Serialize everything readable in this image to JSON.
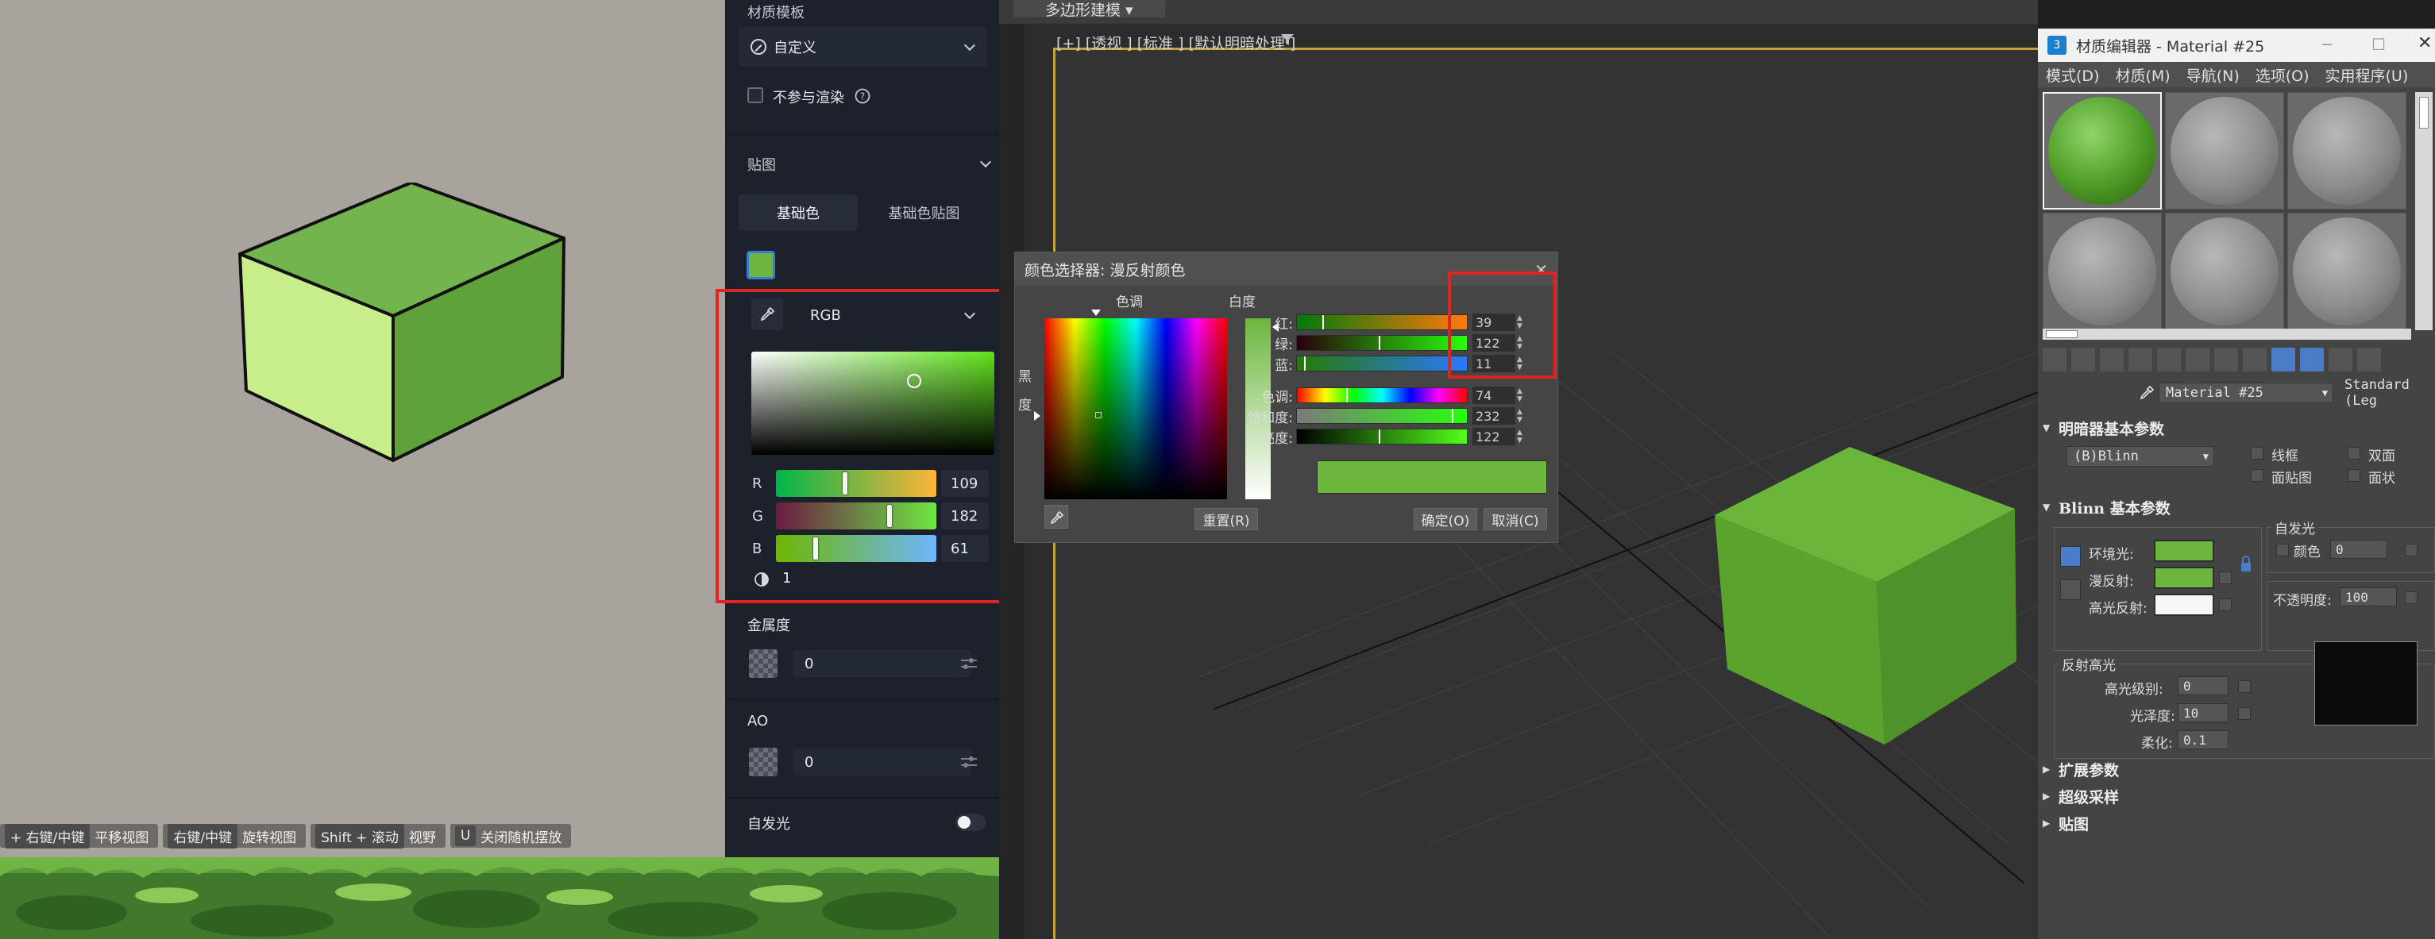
{
  "left_viewport": {
    "shortcuts": [
      {
        "key": "+ 右键/中键",
        "text": "平移视图"
      },
      {
        "key": "右键/中键",
        "text": "旋转视图"
      },
      {
        "key": "Shift + 滚动",
        "text": "视野"
      },
      {
        "key": "U",
        "text": "关闭随机摆放"
      }
    ]
  },
  "prop_panel": {
    "material_template_label": "材质模板",
    "template_value": "自定义",
    "no_render_label": "不参与渲染",
    "map_section_label": "贴图",
    "tabs": [
      "基础色",
      "基础色贴图"
    ],
    "color_mode": "RGB",
    "rgb": {
      "r": 109,
      "g": 182,
      "b": 61
    },
    "channel_labels": [
      "R",
      "G",
      "B"
    ],
    "opacity_value": "1",
    "metalness_label": "金属度",
    "metalness_value": "0",
    "ao_label": "AO",
    "ao_value": "0",
    "emissive_label": "自发光",
    "accent_color": "#6db63d"
  },
  "main_viewport": {
    "menu_button": "多边形建模 ▾",
    "viewport_label": "[+] [透视 ] [标准 ] [默认明暗处理 ]"
  },
  "color_picker": {
    "title": "颜色选择器: 漫反射颜色",
    "hue_label": "色调",
    "whiteness_label": "白度",
    "blackness_label_1": "黑",
    "blackness_label_2": "度",
    "rows": [
      {
        "label": "红:",
        "value": "39",
        "frac": 0.15
      },
      {
        "label": "绿:",
        "value": "122",
        "frac": 0.48
      },
      {
        "label": "蓝:",
        "value": "11",
        "frac": 0.04
      },
      {
        "label": "色调:",
        "value": "74",
        "frac": 0.29
      },
      {
        "label": "饱和度:",
        "value": "232",
        "frac": 0.91
      },
      {
        "label": "亮度:",
        "value": "122",
        "frac": 0.48
      }
    ],
    "reset_button": "重置(R)",
    "ok_button": "确定(O)",
    "cancel_button": "取消(C)"
  },
  "material_editor": {
    "title": "材质编辑器 - Material #25",
    "app_icon_text": "3",
    "menus": [
      "模式(D)",
      "材质(M)",
      "导航(N)",
      "选项(O)",
      "实用程序(U)"
    ],
    "material_name": "Material #25",
    "material_type": "Standard (Leg",
    "shader_section": "明暗器基本参数",
    "shader_value": "(B)Blinn",
    "shader_options": [
      "线框",
      "双面",
      "面贴图",
      "面状"
    ],
    "blinn_section": "Blinn 基本参数",
    "self_illum_label": "自发光",
    "self_illum_color_label": "颜色",
    "self_illum_value": "0",
    "ambient_label": "环境光:",
    "diffuse_label": "漫反射:",
    "specular_label": "高光反射:",
    "opacity_label": "不透明度:",
    "opacity_value": "100",
    "spec_highlights_label": "反射高光",
    "spec_level_label": "高光级别:",
    "spec_level_value": "0",
    "gloss_label": "光泽度:",
    "gloss_value": "10",
    "soften_label": "柔化:",
    "soften_value": "0.1",
    "collapsed_sections": [
      "扩展参数",
      "超级采样",
      "贴图"
    ]
  }
}
